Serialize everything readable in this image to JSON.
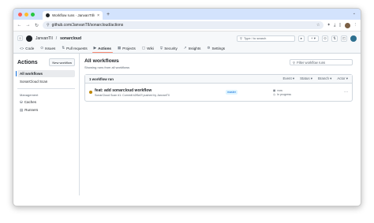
{
  "browser": {
    "tab_title": "Workflow runs · JanvanTIl/sc…",
    "tab_close": "×",
    "new_tab": "+",
    "tab_menu": "⌄",
    "url": "github.com/JanvanTIl/sonarcloud/actions",
    "back": "←",
    "forward": "→",
    "reload": "↻"
  },
  "header": {
    "menu_icon": "≡",
    "owner": "JanvanTIl",
    "separator": "/",
    "repo": "sonarcloud",
    "search_placeholder": "Type / to search",
    "plus": "+ ▾"
  },
  "repo_nav": [
    {
      "icon": "<>",
      "label": "Code"
    },
    {
      "icon": "⊙",
      "label": "Issues"
    },
    {
      "icon": "⇅",
      "label": "Pull requests"
    },
    {
      "icon": "▶",
      "label": "Actions"
    },
    {
      "icon": "▦",
      "label": "Projects"
    },
    {
      "icon": "▢",
      "label": "Wiki"
    },
    {
      "icon": "⛨",
      "label": "Security"
    },
    {
      "icon": "↗",
      "label": "Insights"
    },
    {
      "icon": "⚙",
      "label": "Settings"
    }
  ],
  "sidebar": {
    "title": "Actions",
    "new_workflow": "New workflow",
    "all_workflows": "All workflows",
    "workflow": "SonarCloud Scan",
    "management": "Management",
    "caches": "Caches",
    "runners": "Runners"
  },
  "main": {
    "title": "All workflows",
    "subtitle": "Showing runs from all workflows",
    "filter_placeholder": "Filter workflow runs",
    "runs_count": "1 workflow run",
    "filters": [
      "Event ▾",
      "Status ▾",
      "Branch ▾",
      "Actor ▾"
    ],
    "run": {
      "title": "feat: add sonarcloud workflow",
      "meta": "SonarCloud Scan #1: Commit b2f5a7f pushed by JanvanTIl",
      "branch": "master",
      "time_ago": "now",
      "duration": "In progress",
      "more": "···"
    }
  },
  "colors": {
    "tab_bar": "#d3e3fd",
    "active_tab_underline": "#fd8c73",
    "running_status": "#bf8700",
    "link_blue": "#0969da"
  }
}
